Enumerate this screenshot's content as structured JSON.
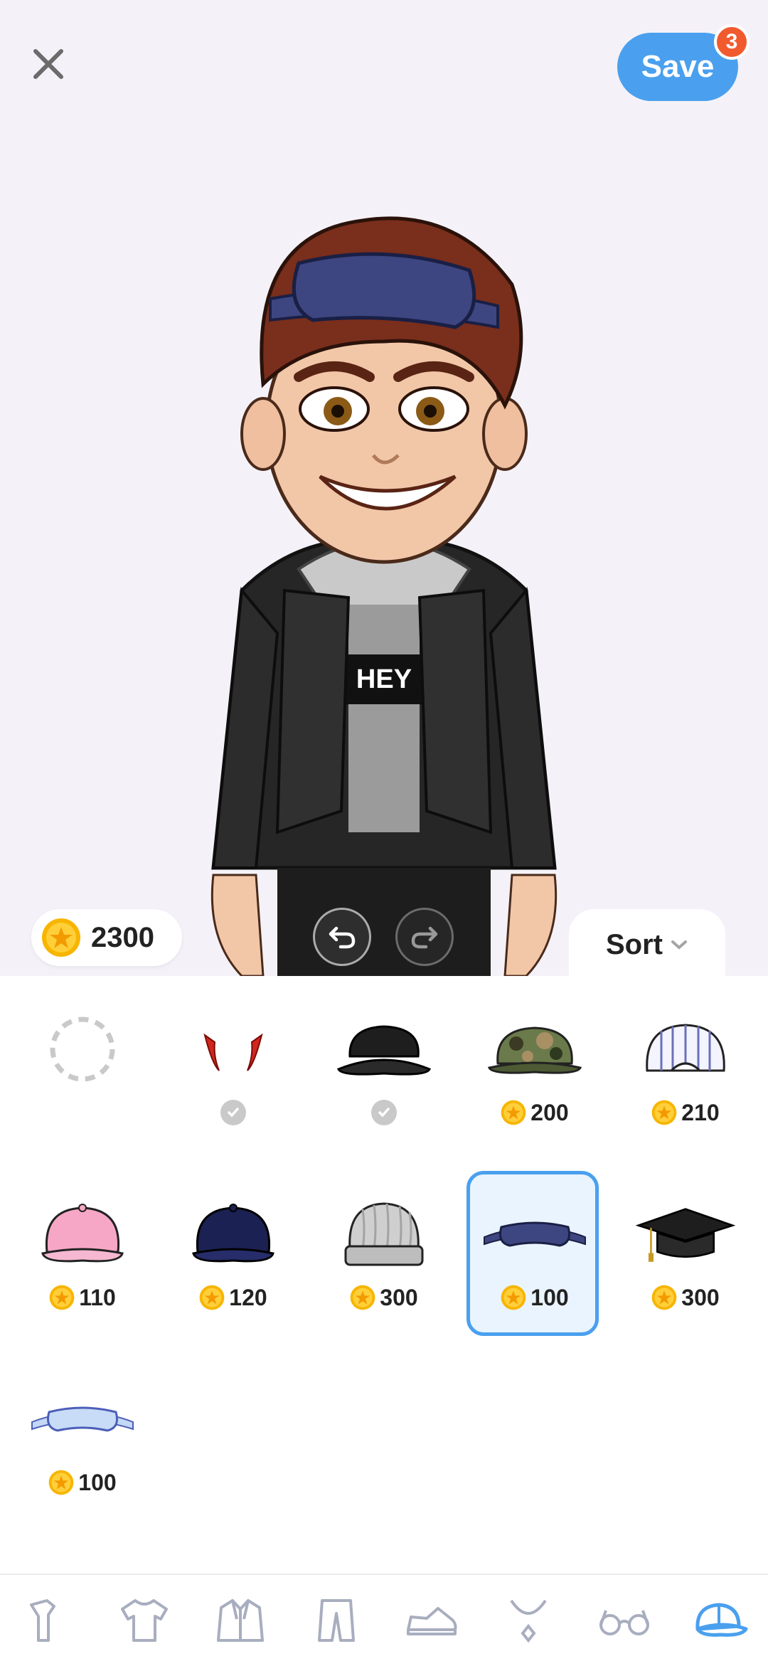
{
  "header": {
    "save_label": "Save",
    "save_badge": "3"
  },
  "balance": {
    "coins": "2300"
  },
  "avatar": {
    "shirt_text": "HEY"
  },
  "sort": {
    "label": "Sort"
  },
  "items": [
    {
      "name": "none",
      "price": ""
    },
    {
      "name": "devil-horns",
      "price": "",
      "owned": true
    },
    {
      "name": "black-beret",
      "price": "",
      "owned": true
    },
    {
      "name": "camo-cap",
      "price": "200"
    },
    {
      "name": "striped-cap",
      "price": "210"
    },
    {
      "name": "pink-cap",
      "price": "110"
    },
    {
      "name": "navy-cap",
      "price": "120"
    },
    {
      "name": "grey-beanie",
      "price": "300"
    },
    {
      "name": "navy-sleep-mask",
      "price": "100",
      "selected": true
    },
    {
      "name": "graduation-cap",
      "price": "300"
    },
    {
      "name": "light-blue-sleep-mask",
      "price": "100"
    }
  ],
  "colors": {
    "accent": "#4aa0ee",
    "badge": "#f15a2e",
    "coin": "#f7b500"
  },
  "nav": [
    "partial-icon",
    "tshirt-icon",
    "jacket-icon",
    "pants-icon",
    "shoe-icon",
    "necklace-icon",
    "glasses-icon",
    "cap-icon"
  ]
}
